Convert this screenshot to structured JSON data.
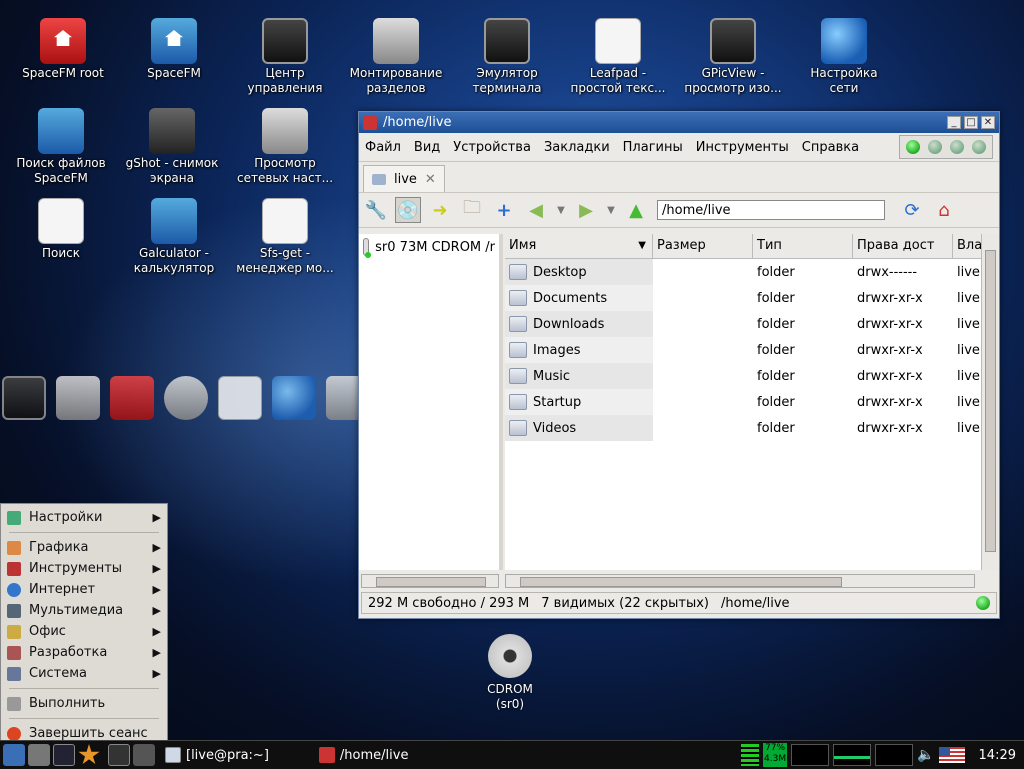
{
  "desktop": {
    "icons": [
      {
        "l1": "SpaceFM root",
        "l2": ""
      },
      {
        "l1": "SpaceFM",
        "l2": ""
      },
      {
        "l1": "Центр",
        "l2": "управления"
      },
      {
        "l1": "Монтирование",
        "l2": "разделов"
      },
      {
        "l1": "Эмулятор",
        "l2": "терминала"
      },
      {
        "l1": "Leafpad -",
        "l2": "простой текс..."
      },
      {
        "l1": "GPicView -",
        "l2": "просмотр изо..."
      },
      {
        "l1": "Настройка",
        "l2": "сети"
      },
      {
        "l1": "Поиск файлов",
        "l2": "SpaceFM"
      },
      {
        "l1": "gShot - снимок",
        "l2": "экрана"
      },
      {
        "l1": "Просмотр",
        "l2": "сетевых наст..."
      },
      {
        "l1": "Поиск",
        "l2": ""
      },
      {
        "l1": "Galculator -",
        "l2": "калькулятор"
      },
      {
        "l1": "Sfs-get -",
        "l2": "менеджер мо..."
      },
      {
        "l1": "CDROM",
        "l2": "(sr0)"
      }
    ]
  },
  "window": {
    "title": "/home/live",
    "menu": [
      "Файл",
      "Вид",
      "Устройства",
      "Закладки",
      "Плагины",
      "Инструменты",
      "Справка"
    ],
    "tab_label": "live",
    "path": "/home/live",
    "side_item": "sr0 73M CDROM /r",
    "columns": [
      "Имя",
      "Размер",
      "Тип",
      "Права дост",
      "Вла"
    ],
    "rows": [
      {
        "name": "Desktop",
        "size": "",
        "type": "folder",
        "perm": "drwx------",
        "owner": "live"
      },
      {
        "name": "Documents",
        "size": "",
        "type": "folder",
        "perm": "drwxr-xr-x",
        "owner": "live"
      },
      {
        "name": "Downloads",
        "size": "",
        "type": "folder",
        "perm": "drwxr-xr-x",
        "owner": "live"
      },
      {
        "name": "Images",
        "size": "",
        "type": "folder",
        "perm": "drwxr-xr-x",
        "owner": "live"
      },
      {
        "name": "Music",
        "size": "",
        "type": "folder",
        "perm": "drwxr-xr-x",
        "owner": "live"
      },
      {
        "name": "Startup",
        "size": "",
        "type": "folder",
        "perm": "drwxr-xr-x",
        "owner": "live"
      },
      {
        "name": "Videos",
        "size": "",
        "type": "folder",
        "perm": "drwxr-xr-x",
        "owner": "live"
      }
    ],
    "status": {
      "free": "292 M свободно / 293 M",
      "visible": "7 видимых (22 скрытых)",
      "path": "/home/live"
    }
  },
  "start_menu": {
    "items": [
      "Настройки",
      "Графика",
      "Инструменты",
      "Интернет",
      "Мультимедиа",
      "Офис",
      "Разработка",
      "Система"
    ],
    "run": "Выполнить",
    "logout": "Завершить сеанс"
  },
  "taskbar": {
    "tasks": [
      "[live@pra:~]",
      "/home/live"
    ],
    "cpu": "77%",
    "mem": "4.3M",
    "clock": "14:29"
  }
}
